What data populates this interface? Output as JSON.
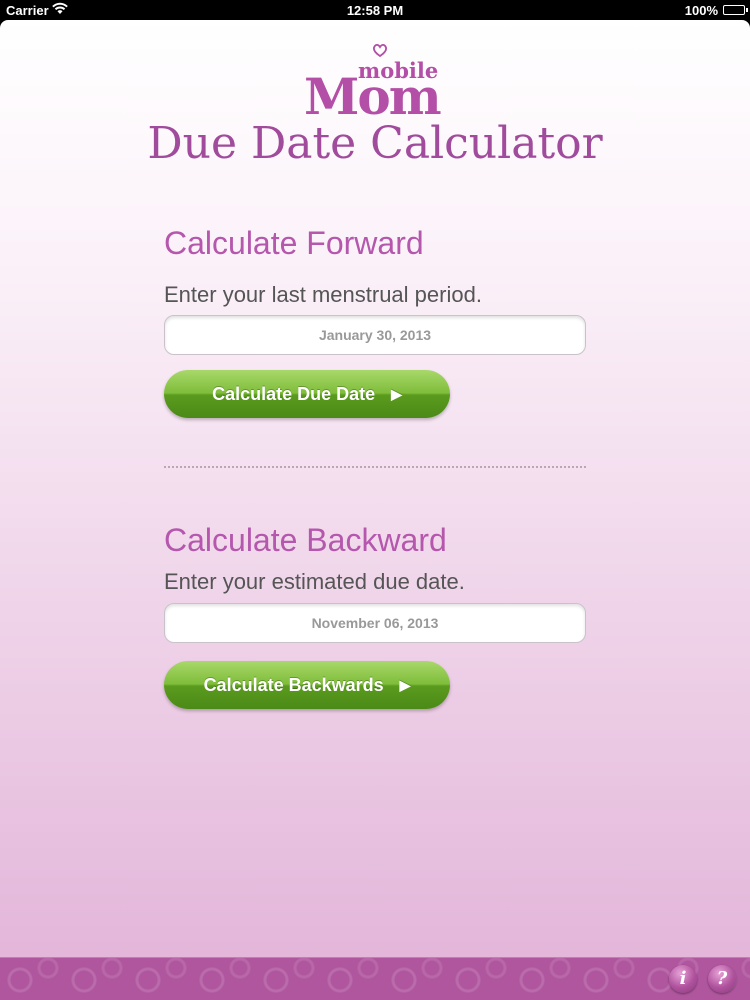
{
  "status_bar": {
    "carrier": "Carrier",
    "time": "12:58 PM",
    "battery": "100%"
  },
  "logo": {
    "mobile": "mobile",
    "mom": "Mom"
  },
  "app_title": "Due Date Calculator",
  "forward": {
    "heading": "Calculate Forward",
    "prompt": "Enter your last menstrual period.",
    "date_value": "January 30, 2013",
    "button_label": "Calculate Due Date"
  },
  "backward": {
    "heading": "Calculate Backward",
    "prompt": "Enter your estimated due date.",
    "date_value": "November 06, 2013",
    "button_label": "Calculate Backwards"
  },
  "footer": {
    "info_label": "i",
    "help_label": "?"
  },
  "colors": {
    "accent": "#b457ad",
    "button_green": "#6aa92b",
    "footer": "#b0569f"
  },
  "icons": [
    "wifi-icon",
    "battery-icon",
    "heart-icon",
    "play-arrow-icon",
    "info-icon",
    "help-icon"
  ]
}
